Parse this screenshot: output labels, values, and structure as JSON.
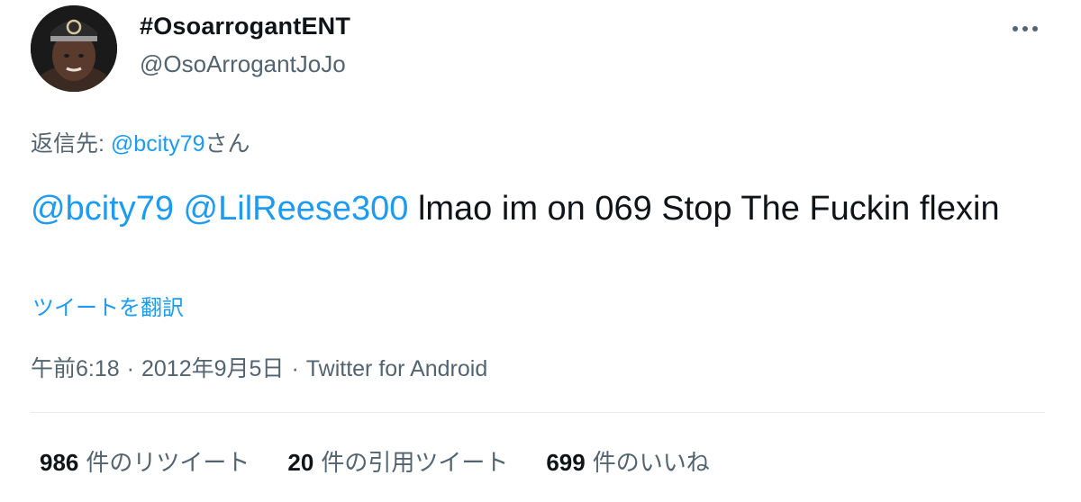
{
  "author": {
    "display_name": "#OsoarrogantENT",
    "handle": "@OsoArrogantJoJo"
  },
  "reply_to": {
    "prefix": "返信先: ",
    "mention": "@bcity79",
    "suffix": "さん"
  },
  "tweet": {
    "mention_1": "@bcity79",
    "mention_2": "@LilReese300",
    "text": "lmao im on 069 Stop The Fuckin flexin"
  },
  "translate_label": "ツイートを翻訳",
  "meta": {
    "time": "午前6:18",
    "date": "2012年9月5日",
    "source": "Twitter for Android",
    "separator": "·"
  },
  "stats": {
    "retweets": {
      "count": "986",
      "label": "件のリツイート"
    },
    "quotes": {
      "count": "20",
      "label": "件の引用ツイート"
    },
    "likes": {
      "count": "699",
      "label": "件のいいね"
    }
  },
  "colors": {
    "link": "#1d9bf0",
    "text": "#0f1419",
    "secondary": "#536471",
    "divider": "#e6ecf0"
  },
  "icons": {
    "more": "more-horizontal-icon"
  }
}
